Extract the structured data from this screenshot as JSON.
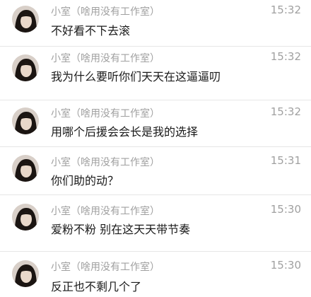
{
  "messages": [
    {
      "sender": "小室（啥用没有工作室）",
      "time": "15:32",
      "text": "不好看不下去滚"
    },
    {
      "sender": "小室（啥用没有工作室）",
      "time": "15:32",
      "text": "我为什么要听你们天天在这逼逼叨"
    },
    {
      "sender": "小室（啥用没有工作室）",
      "time": "15:32",
      "text": "用哪个后援会会长是我的选择"
    },
    {
      "sender": "小室（啥用没有工作室）",
      "time": "15:31",
      "text": "你们助的动？"
    },
    {
      "sender": "小室（啥用没有工作室）",
      "time": "15:30",
      "text": "爱粉不粉 别在这天天带节奏"
    },
    {
      "sender": "小室（啥用没有工作室）",
      "time": "15:30",
      "text": "反正也不剩几个了"
    }
  ]
}
